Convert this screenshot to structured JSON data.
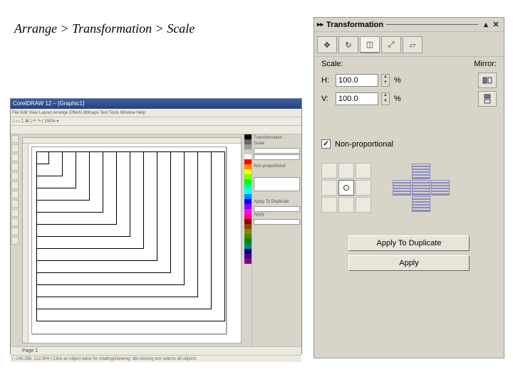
{
  "breadcrumb": "Arrange > Transformation > Scale",
  "docker": {
    "title": "Transformation",
    "tabs": [
      {
        "name": "position-tab",
        "glyph": "✥"
      },
      {
        "name": "rotate-tab",
        "glyph": "↻"
      },
      {
        "name": "scale-tab",
        "glyph": "◫"
      },
      {
        "name": "size-tab",
        "glyph": "⤢"
      },
      {
        "name": "skew-tab",
        "glyph": "▱"
      }
    ],
    "labels": {
      "scale": "Scale:",
      "mirror": "Mirror:",
      "h": "H:",
      "v": "V:"
    },
    "h_value": "100.0",
    "v_value": "100.0",
    "unit": "%",
    "nonprop_label": "Non-proportional",
    "nonprop_checked": true,
    "apply_dup": "Apply To Duplicate",
    "apply": "Apply"
  },
  "app": {
    "title": "CorelDRAW 12 – [Graphic1]",
    "menubar": "File  Edit  View  Layout  Arrange  Effects  Bitmaps  Text  Tools  Window  Help",
    "toolbar": "□  ▭  ⌶  ⌘  |  ↶ ↷  |  100%  ▾",
    "page_tab": "Page 1",
    "statusbar": "( -245.356, 112.004 )   Click an object twice for rotating/skewing; dbl-clicking tool selects all objects"
  },
  "swatches": [
    "#000",
    "#666",
    "#999",
    "#ccc",
    "#fff",
    "#f00",
    "#f80",
    "#ff0",
    "#8f0",
    "#0f0",
    "#0f8",
    "#0ff",
    "#08f",
    "#00f",
    "#80f",
    "#f0f",
    "#f08",
    "#800",
    "#840",
    "#880",
    "#480",
    "#080",
    "#088",
    "#008",
    "#408",
    "#808"
  ]
}
